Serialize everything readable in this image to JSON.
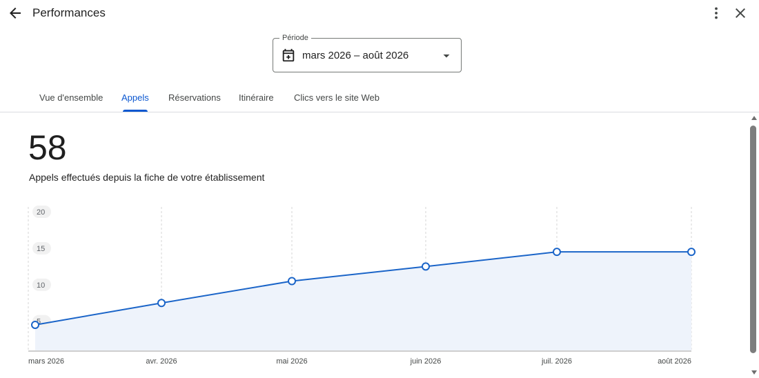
{
  "header": {
    "title": "Performances",
    "back_icon": "arrow-left-icon",
    "more_icon": "more-vert-icon",
    "close_icon": "close-icon"
  },
  "period": {
    "label": "Période",
    "value": "mars 2026 – août 2026",
    "icon": "calendar-icon"
  },
  "tabs": [
    {
      "label": "Vue d'ensemble",
      "active": false
    },
    {
      "label": "Appels",
      "active": true
    },
    {
      "label": "Réservations",
      "active": false
    },
    {
      "label": "Itinéraire",
      "active": false
    },
    {
      "label": "Clics vers le site Web",
      "active": false
    }
  ],
  "summary": {
    "value": "58",
    "description": "Appels effectués depuis la fiche de votre établissement"
  },
  "colors": {
    "accent": "#0b57d0",
    "line": "#1a64c8",
    "area": "#eef3fb"
  },
  "chart_data": {
    "type": "line",
    "categories": [
      "mars 2026",
      "avr. 2026",
      "mai 2026",
      "juin 2026",
      "juil. 2026",
      "août 2026"
    ],
    "values": [
      4.5,
      7.5,
      10.5,
      12.5,
      14.5,
      14.5
    ],
    "yticks": [
      5,
      10,
      15,
      20
    ],
    "ylim": [
      1,
      20
    ],
    "grid": "vertical-dashed"
  }
}
